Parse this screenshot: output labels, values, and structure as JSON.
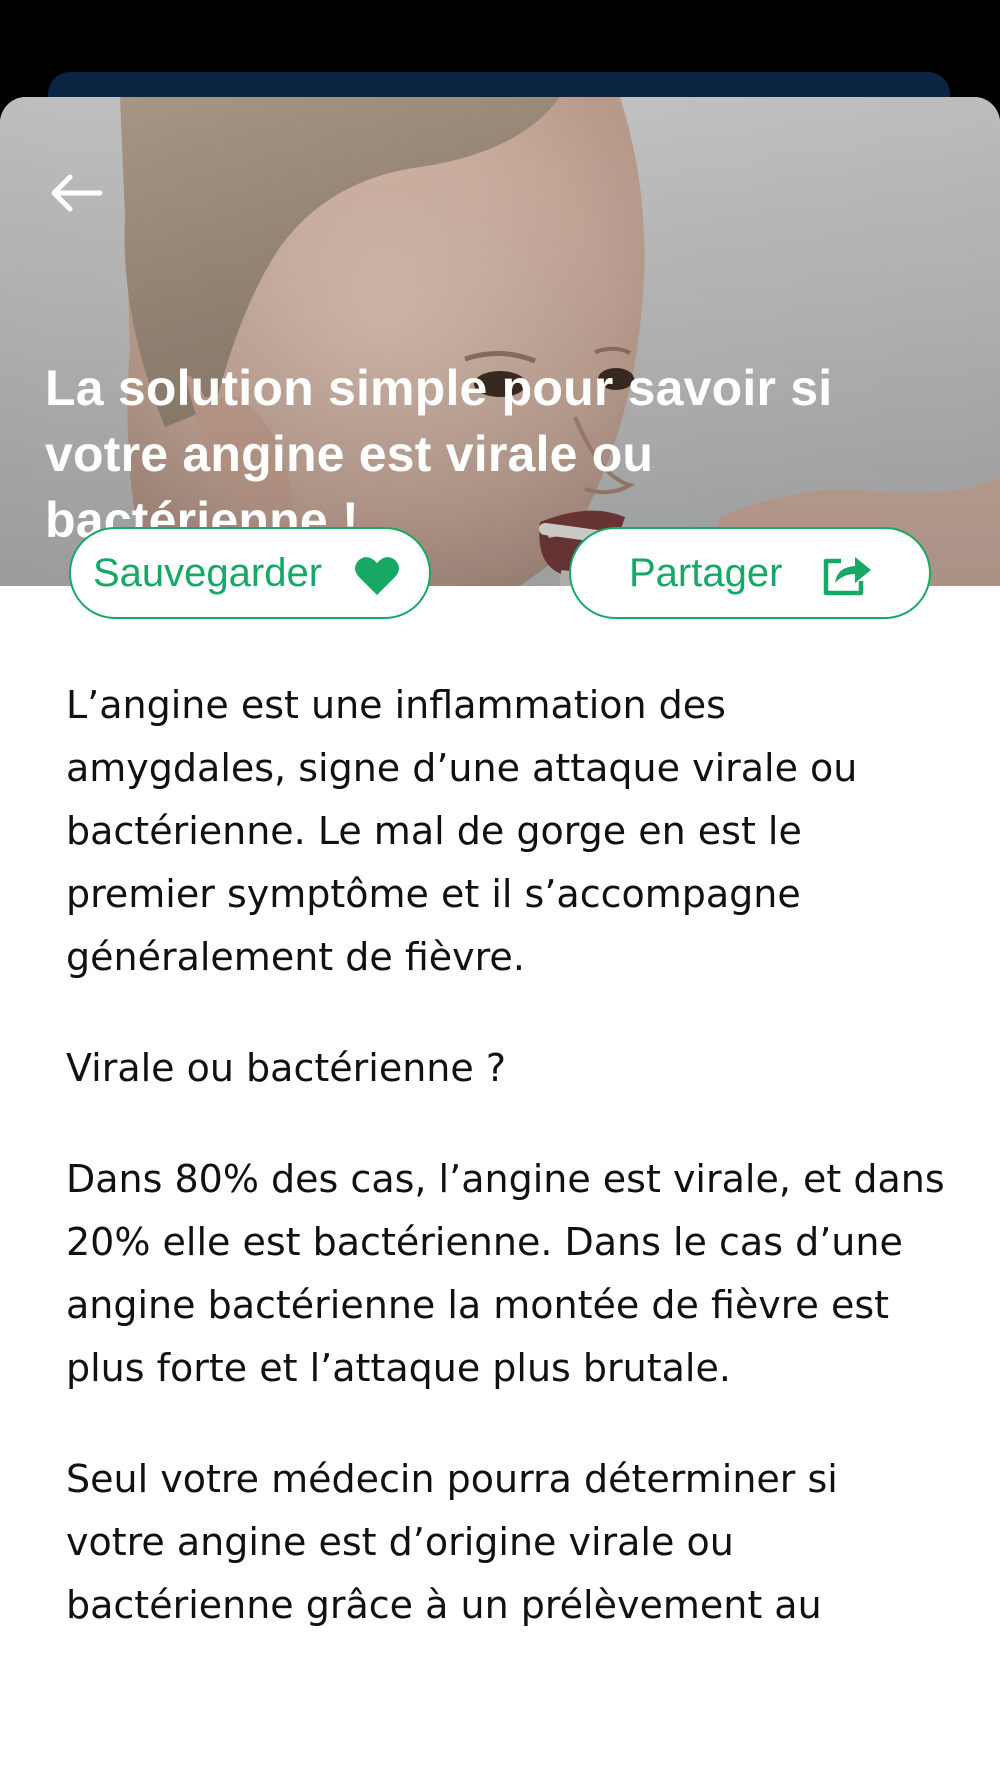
{
  "article": {
    "title": "La solution simple pour savoir si votre angine est virale ou bactérienne !",
    "hero_image": "child-throat-exam-photo",
    "paragraphs": [
      "L’angine est une inflammation des amygdales, signe d’une attaque virale ou bactérienne. Le mal de gorge en est le premier symptôme et il s’accompagne généralement de fièvre.",
      "Virale ou bactérienne ?",
      "Dans 80% des cas, l’angine est virale, et dans 20% elle est bactérienne. Dans le cas d’une angine bactérienne la montée de fièvre est plus forte et l’attaque plus brutale.",
      "Seul votre médecin pourra déterminer si votre angine est d’origine virale ou bactérienne grâce à un prélèvement au"
    ]
  },
  "actions": {
    "save_label": "Sauvegarder",
    "save_icon": "heart-icon",
    "share_label": "Partager",
    "share_icon": "share-icon"
  },
  "navigation": {
    "back_icon": "arrow-left-icon"
  },
  "colors": {
    "accent": "#17a865",
    "status_bar": "#000000",
    "background_card": "#0b2442",
    "text": "#111111"
  }
}
